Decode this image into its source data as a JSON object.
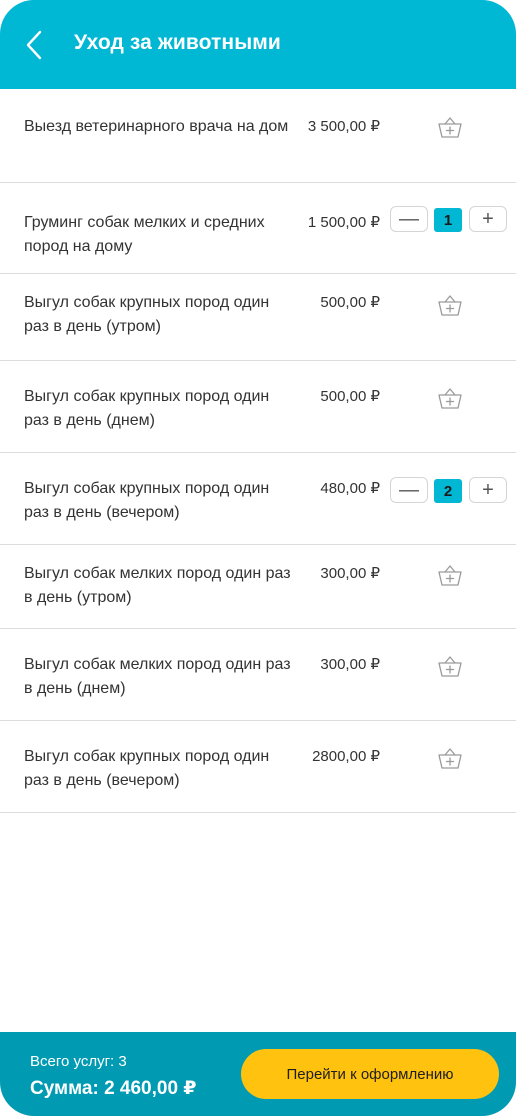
{
  "header": {
    "title": "Уход за животными",
    "back_icon": "chevron-left-icon"
  },
  "services": [
    {
      "name": "Выезд ветеринарного врача на дом",
      "price": "3 500,00 ₽",
      "quantity": null
    },
    {
      "name": "Груминг собак мелких и средних пород на дому",
      "price": "1 500,00 ₽",
      "quantity": "1"
    },
    {
      "name": "Выгул собак крупных пород один раз в день (утром)",
      "price": "500,00 ₽",
      "quantity": null
    },
    {
      "name": "Выгул собак крупных пород один раз в день (днем)",
      "price": "500,00 ₽",
      "quantity": null
    },
    {
      "name": "Выгул собак крупных пород один раз в день (вечером)",
      "price": "480,00 ₽",
      "quantity": "2"
    },
    {
      "name": "Выгул собак мелких пород один раз в день (утром)",
      "price": "300,00 ₽",
      "quantity": null
    },
    {
      "name": "Выгул собак мелких пород один раз в день (днем)",
      "price": "300,00 ₽",
      "quantity": null
    },
    {
      "name": "Выгул собак крупных пород один раз в день (вечером)",
      "price": "2800,00 ₽",
      "quantity": null
    }
  ],
  "stepper": {
    "minus": "—",
    "plus": "+"
  },
  "footer": {
    "total_count": "Всего услуг: 3",
    "total_sum": "Сумма: 2 460,00 ₽",
    "checkout_label": "Перейти к оформлению"
  },
  "colors": {
    "accent": "#00b7d4",
    "footer": "#009bb3",
    "button": "#ffc20e"
  }
}
